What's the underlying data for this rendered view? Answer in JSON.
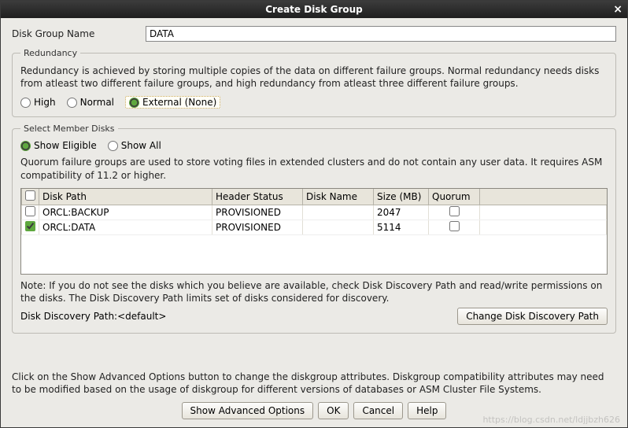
{
  "title": "Create Disk Group",
  "fields": {
    "disk_group_name_label": "Disk Group Name",
    "disk_group_name_value": "DATA"
  },
  "redundancy": {
    "legend": "Redundancy",
    "desc": "Redundancy is achieved by storing multiple copies of the data on different failure groups. Normal redundancy needs disks from atleast two different failure groups, and high redundancy from atleast three different failure groups.",
    "options": {
      "high": "High",
      "normal": "Normal",
      "external": "External (None)"
    },
    "selected": "external"
  },
  "member": {
    "legend": "Select Member Disks",
    "filter": {
      "eligible": "Show Eligible",
      "all": "Show All",
      "selected": "eligible"
    },
    "desc": "Quorum failure groups are used to store voting files in extended clusters and do not contain any user data. It requires ASM compatibility of 11.2 or higher.",
    "columns": {
      "disk_path": "Disk Path",
      "header_status": "Header Status",
      "disk_name": "Disk Name",
      "size_mb": "Size (MB)",
      "quorum": "Quorum"
    },
    "rows": [
      {
        "checked": false,
        "disk_path": "ORCL:BACKUP",
        "header_status": "PROVISIONED",
        "disk_name": "",
        "size_mb": "2047",
        "quorum": false
      },
      {
        "checked": true,
        "disk_path": "ORCL:DATA",
        "header_status": "PROVISIONED",
        "disk_name": "",
        "size_mb": "5114",
        "quorum": false
      }
    ],
    "note": "Note: If you do not see the disks which you believe are available, check Disk Discovery Path and read/write permissions on the disks. The Disk Discovery Path limits set of disks considered for discovery.",
    "path_label": "Disk Discovery Path:<default>",
    "change_path_btn": "Change Disk Discovery Path"
  },
  "footer_note": "Click on the Show Advanced Options button to change the diskgroup attributes. Diskgroup compatibility attributes may need to be modified based on the usage of diskgroup for different versions of databases or ASM Cluster File Systems.",
  "buttons": {
    "advanced": "Show Advanced Options",
    "ok": "OK",
    "cancel": "Cancel",
    "help": "Help"
  },
  "watermark": "https://blog.csdn.net/ldjjbzh626"
}
